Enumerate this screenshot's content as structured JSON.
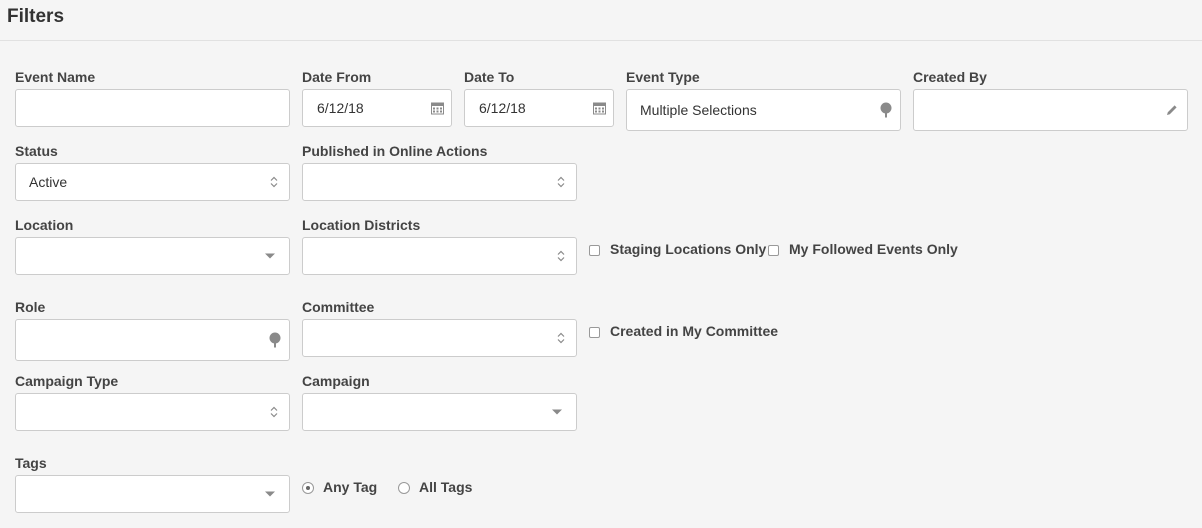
{
  "header": {
    "title": "Filters"
  },
  "fields": {
    "event_name": {
      "label": "Event Name",
      "value": ""
    },
    "date_from": {
      "label": "Date From",
      "value": "6/12/18"
    },
    "date_to": {
      "label": "Date To",
      "value": "6/12/18"
    },
    "event_type": {
      "label": "Event Type",
      "value": "Multiple Selections"
    },
    "created_by": {
      "label": "Created By",
      "value": ""
    },
    "status": {
      "label": "Status",
      "value": "Active"
    },
    "published": {
      "label": "Published in Online Actions",
      "value": ""
    },
    "location": {
      "label": "Location",
      "value": ""
    },
    "location_districts": {
      "label": "Location Districts",
      "value": ""
    },
    "role": {
      "label": "Role",
      "value": ""
    },
    "committee": {
      "label": "Committee",
      "value": ""
    },
    "campaign_type": {
      "label": "Campaign Type",
      "value": ""
    },
    "campaign": {
      "label": "Campaign",
      "value": ""
    },
    "tags": {
      "label": "Tags",
      "value": ""
    }
  },
  "checkboxes": {
    "staging": {
      "label": "Staging Locations Only",
      "checked": false
    },
    "followed": {
      "label": "My Followed Events Only",
      "checked": false
    },
    "my_committee": {
      "label": "Created in My Committee",
      "checked": false
    }
  },
  "tag_match": {
    "any": {
      "label": "Any Tag",
      "selected": true
    },
    "all": {
      "label": "All Tags",
      "selected": false
    }
  },
  "icons": {
    "calendar": "calendar-icon",
    "tree": "tree-icon",
    "pencil": "pencil-icon",
    "updown": "sort-updown-icon",
    "caret": "caret-down-icon"
  },
  "colors": {
    "background": "#f5f5f5",
    "field_border": "#cccccc",
    "icon": "#8a8a8a",
    "label": "#444444"
  }
}
